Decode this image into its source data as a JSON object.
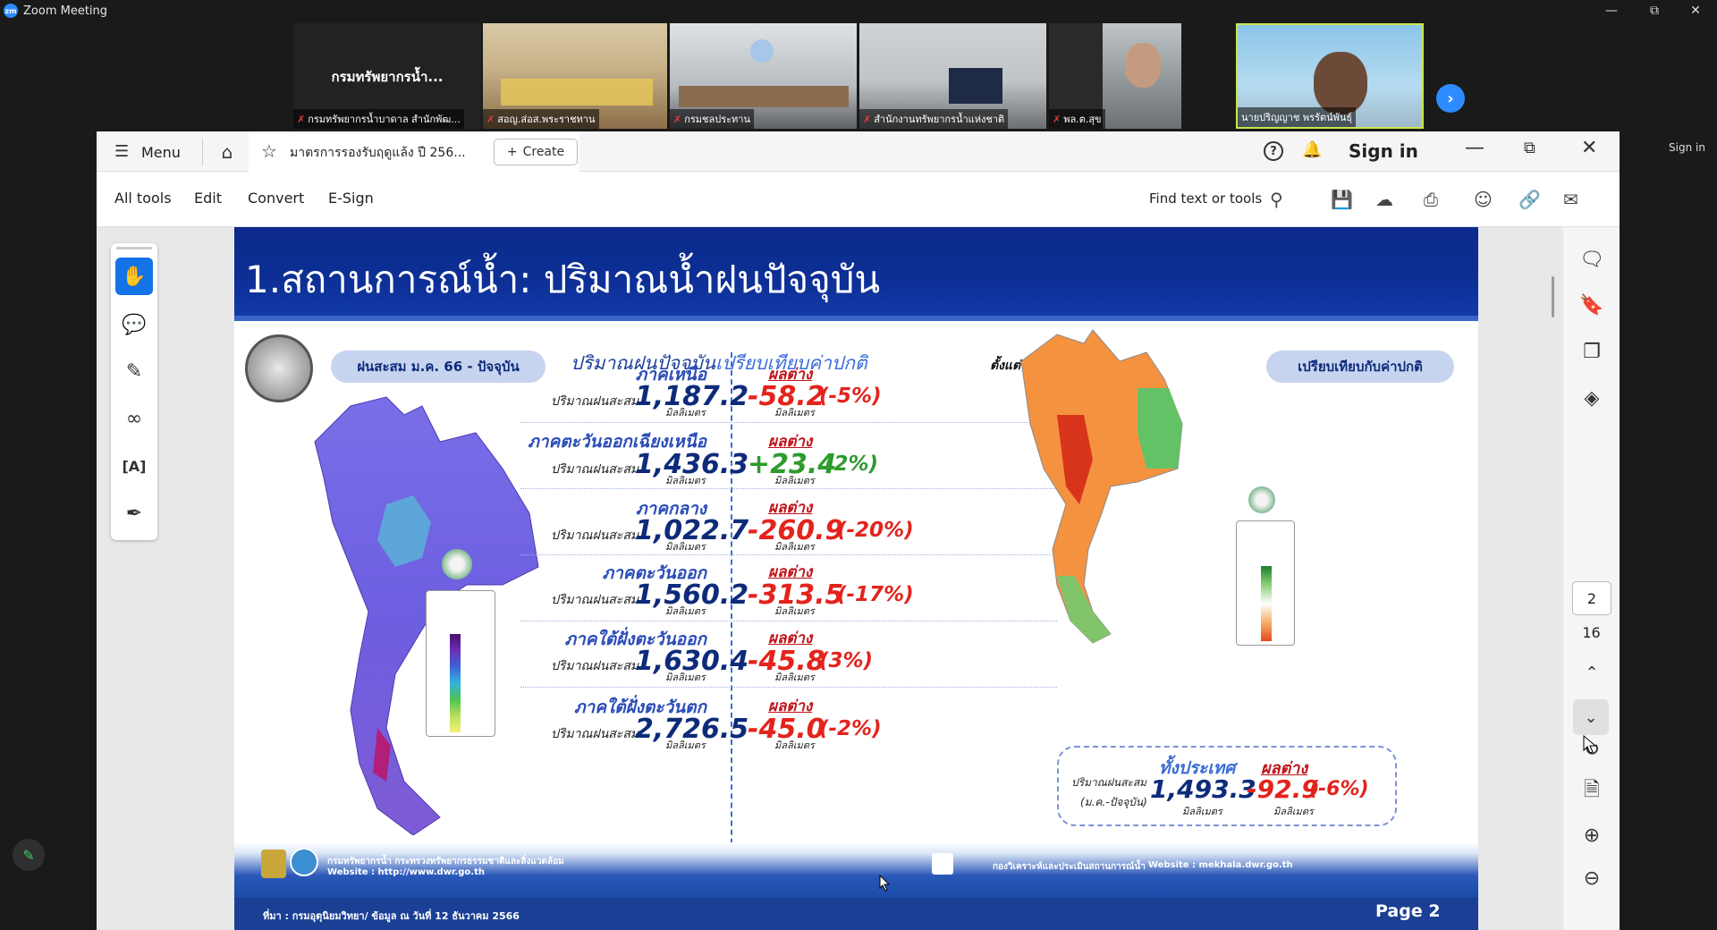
{
  "zoom": {
    "window_title": "Zoom Meeting",
    "sign_in": "Sign in",
    "tiles": [
      {
        "name": "กรมทรัพยากรน้ำบาดาล สำนักพัฒ...",
        "muted": true,
        "label": "กรมทรัพยากรน้ำ..."
      },
      {
        "name": "สอญ.ส่อส.พระราชทาน",
        "muted": true
      },
      {
        "name": "กรมชลประทาน",
        "muted": true
      },
      {
        "name": "สำนักงานทรัพยากรน้ำแห่งชาติ",
        "muted": true
      },
      {
        "name": "พล.ต.สุข",
        "muted": true
      },
      {
        "name": "นายปริญญาช พรรัตน์พันธุ์",
        "muted": false
      }
    ]
  },
  "acrobat": {
    "menu_label": "Menu",
    "tab_title": "มาตรการรองรับฤดูแล้ง ปี 256...",
    "create_label": "Create",
    "sign_in_label": "Sign in",
    "menus": [
      "All tools",
      "Edit",
      "Convert",
      "E-Sign"
    ],
    "find_label": "Find text or tools",
    "page_current": "2",
    "page_total": "16"
  },
  "slide": {
    "title": "1.สถานการณ์น้ำ: ปริมาณน้ำฝนปัจจุบัน",
    "left_pill": "ฝนสะสม ม.ค. 66 - ปัจจุบัน",
    "subtitle_a": "ปริมาณฝนปัจจุบัน",
    "subtitle_b": "เปรียบเทียบค่าปกติ",
    "since": "ตั้งแต่ 1 ม.ค. - ปัจจุบัน",
    "right_pill": "เปรียบเทียบกับค่าปกติ",
    "amount_label": "ปริมาณฝนสะสม",
    "unit": "มิลลิเมตร",
    "diff_label": "ผลต่าง",
    "regions": [
      {
        "name": "ภาคเหนือ",
        "amount": "1,187.2",
        "diff": "-58.2",
        "pct": "(-5%)",
        "sign": "neg"
      },
      {
        "name": "ภาคตะวันออกเฉียงเหนือ",
        "amount": "1,436.3",
        "diff": "+23.4",
        "pct": "(2%)",
        "sign": "pos"
      },
      {
        "name": "ภาคกลาง",
        "amount": "1,022.7",
        "diff": "-260.9",
        "pct": "(-20%)",
        "sign": "neg"
      },
      {
        "name": "ภาคตะวันออก",
        "amount": "1,560.2",
        "diff": "-313.5",
        "pct": "(-17%)",
        "sign": "neg"
      },
      {
        "name": "ภาคใต้ฝั่งตะวันออก",
        "amount": "1,630.4",
        "diff": "-45.8",
        "pct": "(3%)",
        "sign": "neg"
      },
      {
        "name": "ภาคใต้ฝั่งตะวันตก",
        "amount": "2,726.5",
        "diff": "-45.0",
        "pct": "(-2%)",
        "sign": "neg"
      }
    ],
    "country": {
      "name": "ทั้งประเทศ",
      "label1": "ปริมาณฝนสะสม",
      "label2": "(ม.ค.-ปัจจุบัน)",
      "amount": "1,493.3",
      "diff_label": "ผลต่าง",
      "diff": "-92.9",
      "pct": "(-6%)"
    },
    "footer": {
      "org": "กรมทรัพยากรน้ำ กระทรวงทรัพยากรธรรมชาติและสิ่งแวดล้อม",
      "website_left": "Website : http://www.dwr.go.th",
      "org_right": "กองวิเคราะห์และประเมินสถานการณ์น้ำ",
      "website_right": "Website : mekhala.dwr.go.th",
      "source": "ที่มา : กรมอุตุนิยมวิทยา/ ข้อมูล ณ วันที่ 12 ธันวาคม 2566",
      "page": "Page 2"
    }
  }
}
